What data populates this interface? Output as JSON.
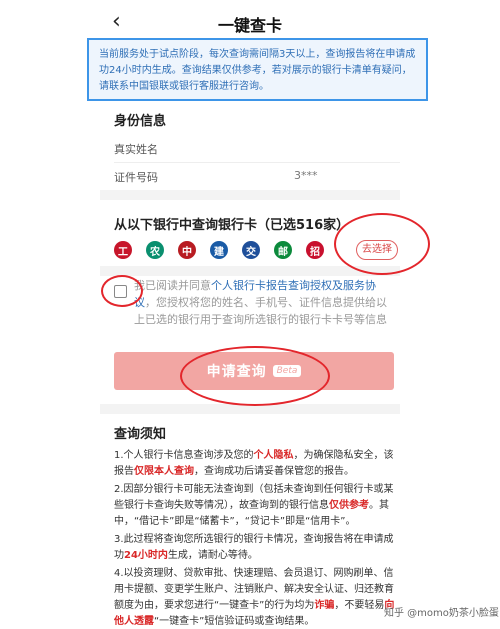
{
  "header": {
    "back_icon": "‹",
    "title": "一键查卡"
  },
  "notice": {
    "text": "当前服务处于试点阶段，每次查询需间隔3天以上，查询报告将在申请成功24小时内生成。查询结果仅供参考，若对展示的银行卡清单有疑问，请联系中国银联或银行客服进行咨询。"
  },
  "identity": {
    "section_title": "身份信息",
    "name_label": "真实姓名",
    "name_value": "",
    "id_label": "证件号码",
    "id_value": "3***"
  },
  "banks": {
    "section_title": "从以下银行中查询银行卡（已选516家）",
    "icons": [
      {
        "name": "icbc-icon",
        "color": "#c7162b",
        "glyph": "工"
      },
      {
        "name": "abc-icon",
        "color": "#0a8f6f",
        "glyph": "农"
      },
      {
        "name": "boc-icon",
        "color": "#b81c22",
        "glyph": "中"
      },
      {
        "name": "ccb-icon",
        "color": "#1a5ba6",
        "glyph": "建"
      },
      {
        "name": "bocom-icon",
        "color": "#1f4f9a",
        "glyph": "交"
      },
      {
        "name": "psbc-icon",
        "color": "#0c8a3c",
        "glyph": "邮"
      },
      {
        "name": "cmb-icon",
        "color": "#c8102e",
        "glyph": "招"
      }
    ],
    "select_button": "去选择"
  },
  "consent": {
    "prefix": "我已阅读并同意",
    "link": "个人银行卡报告查询授权及服务协议",
    "suffix": "，您授权将您的姓名、手机号、证件信息提供给以上已选的银行用于查询所选银行的银行卡卡号等信息"
  },
  "submit": {
    "label": "申请查询",
    "badge": "Beta"
  },
  "notes": {
    "title": "查询须知",
    "n1a": "1.个人银行卡信息查询涉及您的",
    "n1b": "个人隐私",
    "n1c": "，为确保隐私安全，该报告",
    "n1d": "仅限本人查询",
    "n1e": "，查询成功后请妥善保管您的报告。",
    "n2a": "2.因部分银行卡可能无法查询到（包括未查询到任何银行卡或某些银行卡查询失败等情况），故查询到的银行信息",
    "n2b": "仅供参考",
    "n2c": "。其中，“借记卡”即是“储蓄卡”，“贷记卡”即是“信用卡”。",
    "n3a": "3.此过程将查询您所选银行的银行卡情况，查询报告将在申请成功",
    "n3b": "24小时内",
    "n3c": "生成，请耐心等待。",
    "n4a": "4.以投资理财、贷款审批、快速理赔、会员退订、网购刷单、信用卡提额、变更学生账户、注销账户、解决安全认证、归还教育额度为由，要求您进行“一键查卡”的行为均为",
    "n4b": "诈骗",
    "n4c": "，不要轻易",
    "n4d": "向他人透露",
    "n4e": "“一键查卡”短信验证码或查询结果。"
  },
  "watermark": "知乎 @momo奶茶小脸蛋"
}
